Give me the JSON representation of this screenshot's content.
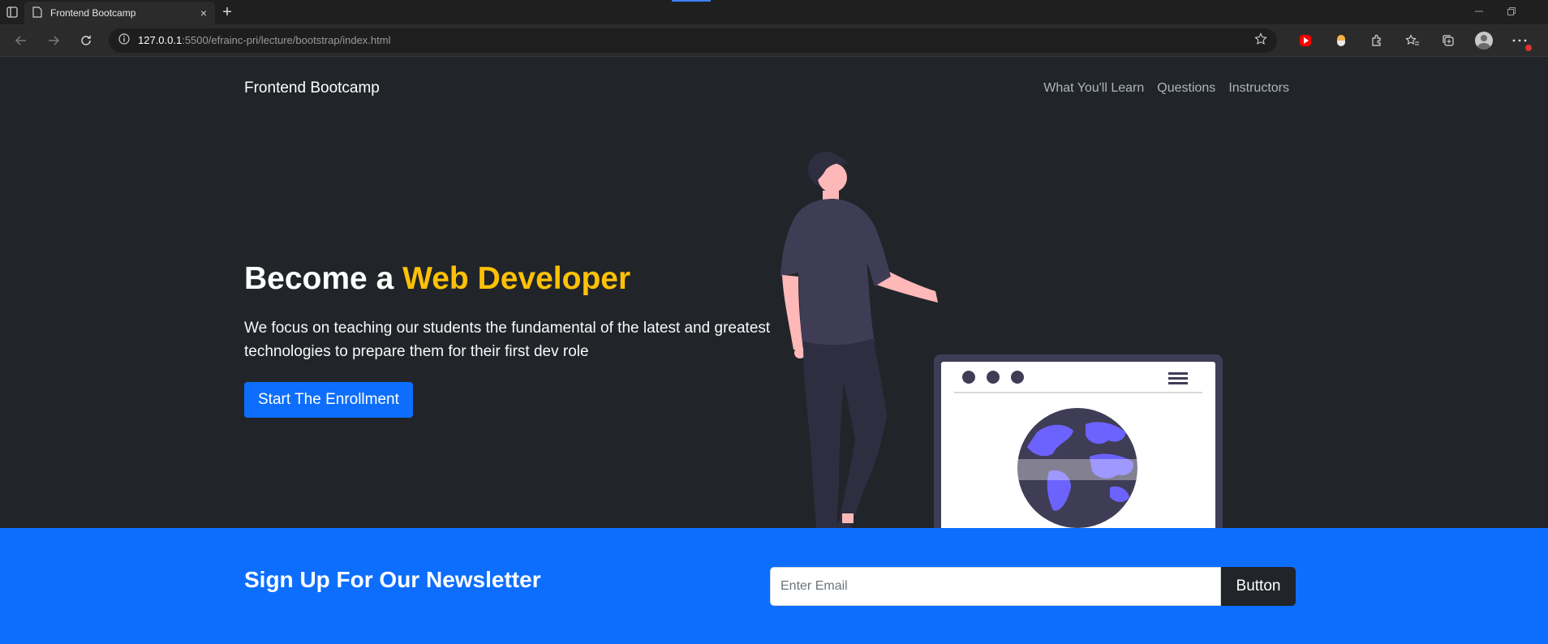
{
  "browser": {
    "tab_title": "Frontend Bootcamp",
    "url_host": "127.0.0.1",
    "url_path": ":5500/efrainc-pri/lecture/bootstrap/index.html",
    "new_tab_glyph": "+",
    "close_glyph": "×"
  },
  "navbar": {
    "brand": "Frontend Bootcamp",
    "links": [
      "What You'll Learn",
      "Questions",
      "Instructors"
    ]
  },
  "hero": {
    "title_prefix": "Become a ",
    "title_accent": "Web Developer",
    "lead": "We focus on teaching our students the fundamental of the latest and greatest technologies to prepare them for their first dev role",
    "cta_label": "Start The Enrollment"
  },
  "newsletter": {
    "title": "Sign Up For Our Newsletter",
    "email_placeholder": "Enter Email",
    "button_label": "Button"
  },
  "colors": {
    "accent": "#ffc107",
    "primary": "#0d6efd",
    "dark_bg": "#212529"
  }
}
